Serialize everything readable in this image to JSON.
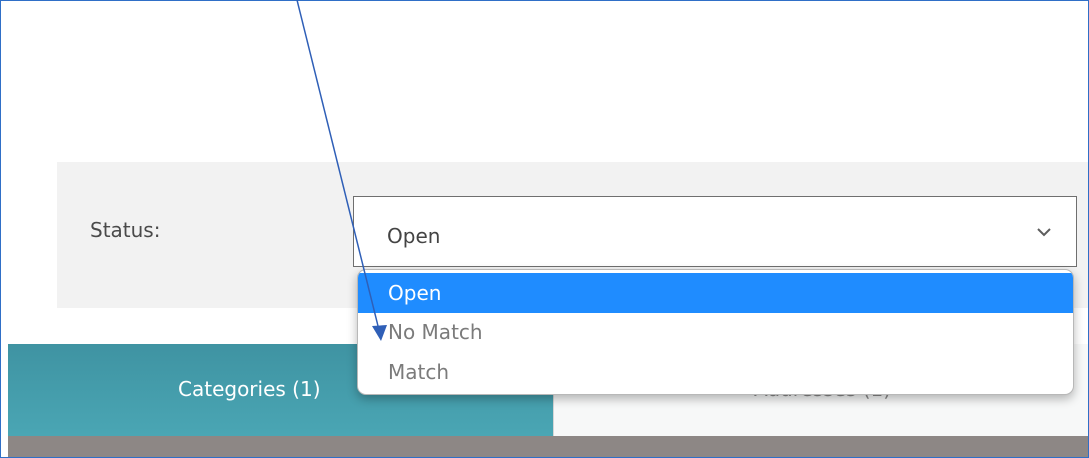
{
  "status_filter": {
    "label": "Status:",
    "selected_value": "Open",
    "options": [
      "Open",
      "No Match",
      "Match"
    ],
    "icon": "chevron-down-icon"
  },
  "tabs": [
    {
      "label": "Categories (1)",
      "active": true
    },
    {
      "label": "Addresses (1)",
      "active": false
    }
  ],
  "colors": {
    "selected_option": "#1f8cff",
    "active_tab": "#45a0ae",
    "annotation_arrow": "#2f5fb7",
    "frame_border": "#2f6fc7"
  }
}
